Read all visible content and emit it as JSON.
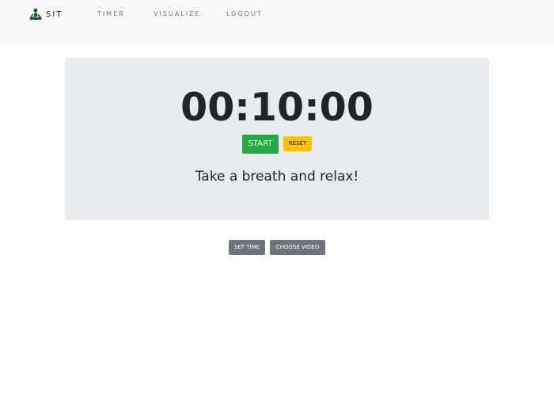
{
  "navbar": {
    "brand": "SIT",
    "brand_icon": "meditation-icon",
    "links": [
      {
        "label": "TIMER"
      },
      {
        "label": "VISUALIZE"
      },
      {
        "label": "LOGOUT"
      }
    ]
  },
  "timer": {
    "display": "00:10:00",
    "start_label": "START",
    "reset_label": "RESET",
    "message": "Take a breath and relax!"
  },
  "controls": {
    "set_time_label": "SET TIME",
    "choose_video_label": "CHOOSE VIDEO"
  },
  "colors": {
    "navbar_bg": "#f8f9fa",
    "panel_bg": "#e9ecef",
    "start": "#28a745",
    "reset": "#ffc107",
    "secondary": "#6c757d"
  }
}
